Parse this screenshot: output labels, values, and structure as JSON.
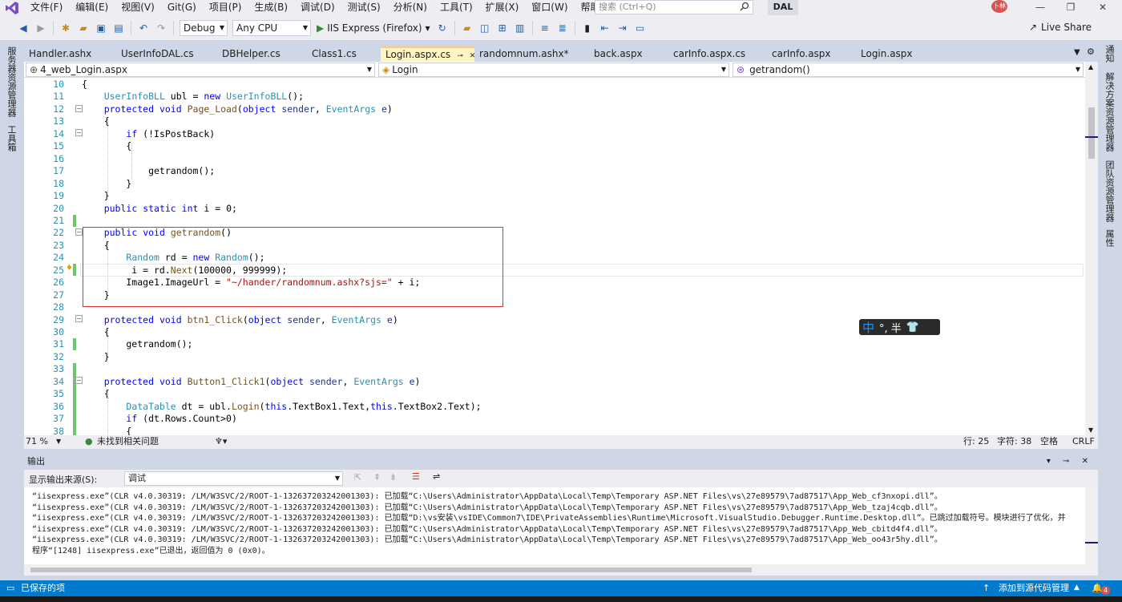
{
  "menu": [
    "文件(F)",
    "编辑(E)",
    "视图(V)",
    "Git(G)",
    "项目(P)",
    "生成(B)",
    "调试(D)",
    "测试(S)",
    "分析(N)",
    "工具(T)",
    "扩展(X)",
    "窗口(W)",
    "帮助(H)"
  ],
  "search_placeholder": "搜索 (Ctrl+Q)",
  "solution_badge": "DAL",
  "avatar_text": "卜林",
  "toolbar": {
    "config": "Debug",
    "platform": "Any CPU",
    "run_target": "IIS Express (Firefox)",
    "live_share": "Live Share"
  },
  "left_tabs": [
    "服务器资源管理器",
    "工具箱"
  ],
  "right_tabs": [
    "通知",
    "解决方案资源管理器",
    "团队资源管理器",
    "属性"
  ],
  "doc_tabs": [
    {
      "label": "Handler.ashx",
      "active": false
    },
    {
      "label": "UserInfoDAL.cs",
      "active": false
    },
    {
      "label": "DBHelper.cs",
      "active": false
    },
    {
      "label": "Class1.cs",
      "active": false
    },
    {
      "label": "Login.aspx.cs",
      "active": true
    },
    {
      "label": "randomnum.ashx*",
      "active": false
    },
    {
      "label": "back.aspx",
      "active": false
    },
    {
      "label": "carInfo.aspx.cs",
      "active": false
    },
    {
      "label": "carInfo.aspx",
      "active": false
    },
    {
      "label": "Login.aspx",
      "active": false
    }
  ],
  "nav": {
    "project": "4_web_Login.aspx",
    "class": "Login",
    "member": "getrandom()"
  },
  "code_lines": [
    {
      "n": "10",
      "html": "{"
    },
    {
      "n": "11",
      "html": "    <span class='ty'>UserInfoBLL</span> ubl = <span class='kw'>new</span> <span class='ty'>UserInfoBLL</span>();"
    },
    {
      "n": "12",
      "html": "    <span class='kw'>protected</span> <span class='kw'>void</span> <span class='ident'>Page_Load</span>(<span class='kw'>object</span> <span class='par'>sender</span>, <span class='ty'>EventArgs</span> <span class='par'>e</span>)"
    },
    {
      "n": "13",
      "html": "    {"
    },
    {
      "n": "14",
      "html": "        <span class='kw'>if</span> (!IsPostBack)"
    },
    {
      "n": "15",
      "html": "        {"
    },
    {
      "n": "16",
      "html": ""
    },
    {
      "n": "17",
      "html": "            getrandom();"
    },
    {
      "n": "18",
      "html": "        }"
    },
    {
      "n": "19",
      "html": "    }"
    },
    {
      "n": "20",
      "html": "    <span class='kw'>public</span> <span class='kw'>static</span> <span class='kw'>int</span> i = 0;"
    },
    {
      "n": "21",
      "html": ""
    },
    {
      "n": "22",
      "html": "    <span class='kw'>public</span> <span class='kw'>void</span> <span class='ident'>getrandom</span>()"
    },
    {
      "n": "23",
      "html": "    {"
    },
    {
      "n": "24",
      "html": "        <span class='ty'>Random</span> rd = <span class='kw'>new</span> <span class='ty'>Random</span>();"
    },
    {
      "n": "25",
      "html": "         i = rd.<span class='ident'>Next</span>(100000, 999999);"
    },
    {
      "n": "26",
      "html": "        Image1.ImageUrl = <span class='str'>\"~/hander/randomnum.ashx?sjs=\"</span> + i;"
    },
    {
      "n": "27",
      "html": "    }"
    },
    {
      "n": "28",
      "html": ""
    },
    {
      "n": "29",
      "html": "    <span class='kw'>protected</span> <span class='kw'>void</span> <span class='ident'>btn1_Click</span>(<span class='kw'>object</span> <span class='par'>sender</span>, <span class='ty'>EventArgs</span> <span class='par'>e</span>)"
    },
    {
      "n": "30",
      "html": "    {"
    },
    {
      "n": "31",
      "html": "        getrandom();"
    },
    {
      "n": "32",
      "html": "    }"
    },
    {
      "n": "33",
      "html": ""
    },
    {
      "n": "34",
      "html": "    <span class='kw'>protected</span> <span class='kw'>void</span> <span class='ident'>Button1_Click1</span>(<span class='kw'>object</span> <span class='par'>sender</span>, <span class='ty'>EventArgs</span> <span class='par'>e</span>)"
    },
    {
      "n": "35",
      "html": "    {"
    },
    {
      "n": "36",
      "html": "        <span class='ty'>DataTable</span> dt = ubl.<span class='ident'>Login</span>(<span class='kw'>this</span>.TextBox1.Text,<span class='kw'>this</span>.TextBox2.Text);"
    },
    {
      "n": "37",
      "html": "        <span class='kw'>if</span> (dt.Rows.Count&gt;0)"
    },
    {
      "n": "38",
      "html": "        {"
    }
  ],
  "ime": {
    "lang": "中",
    "rest": "°, 半"
  },
  "editor_status": {
    "zoom": "71 %",
    "issues": "未找到相关问题",
    "line": "行: 25",
    "char": "字符: 38",
    "space": "空格",
    "eol": "CRLF"
  },
  "output": {
    "title": "输出",
    "source_label": "显示输出来源(S):",
    "source_value": "调试",
    "lines": [
      "“iisexpress.exe”(CLR v4.0.30319: /LM/W3SVC/2/ROOT-1-132637203242001303): 已加载“C:\\Users\\Administrator\\AppData\\Local\\Temp\\Temporary ASP.NET Files\\vs\\27e89579\\7ad87517\\App_Web_cf3nxopi.dll”。",
      "“iisexpress.exe”(CLR v4.0.30319: /LM/W3SVC/2/ROOT-1-132637203242001303): 已加载“C:\\Users\\Administrator\\AppData\\Local\\Temp\\Temporary ASP.NET Files\\vs\\27e89579\\7ad87517\\App_Web_tzaj4cqb.dll”。",
      "“iisexpress.exe”(CLR v4.0.30319: /LM/W3SVC/2/ROOT-1-132637203242001303): 已加载“D:\\vs安装\\vsIDE\\Common7\\IDE\\PrivateAssemblies\\Runtime\\Microsoft.VisualStudio.Debugger.Runtime.Desktop.dll”。已跳过加载符号。模块进行了优化，并",
      "“iisexpress.exe”(CLR v4.0.30319: /LM/W3SVC/2/ROOT-1-132637203242001303): 已加载“C:\\Users\\Administrator\\AppData\\Local\\Temp\\Temporary ASP.NET Files\\vs\\27e89579\\7ad87517\\App_Web_cbitd4f4.dll”。",
      "“iisexpress.exe”(CLR v4.0.30319: /LM/W3SVC/2/ROOT-1-132637203242001303): 已加载“C:\\Users\\Administrator\\AppData\\Local\\Temp\\Temporary ASP.NET Files\\vs\\27e89579\\7ad87517\\App_Web_oo43r5hy.dll”。",
      "程序“[1248] iisexpress.exe”已退出，返回值为 0 (0x0)。"
    ]
  },
  "app_status": {
    "saved": "已保存的项",
    "source_control": "添加到源代码管理",
    "notifications": "4"
  }
}
